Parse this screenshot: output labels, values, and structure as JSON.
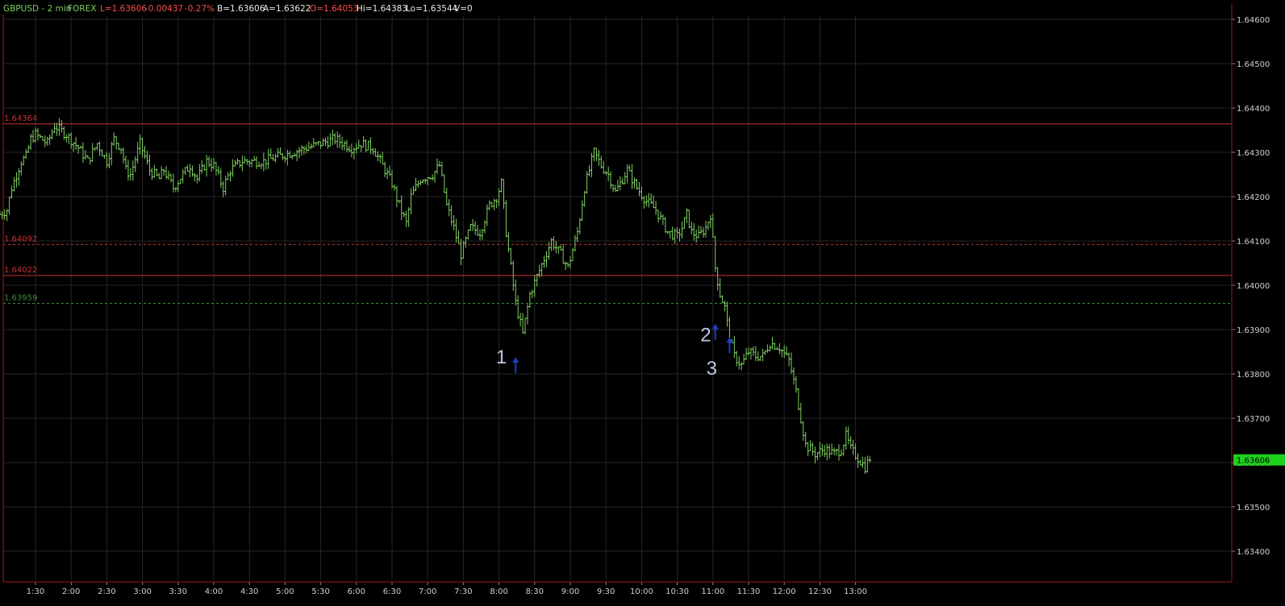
{
  "header": {
    "symbol": "GBPUSD - 2 min",
    "market": "FOREX",
    "last": "L=1.63606",
    "change": "-0.00437",
    "change_pct": "-0.27%",
    "bid": "B=1.63606",
    "ask": "A=1.63622",
    "open": "O=1.64053",
    "high": "Hi=1.64383",
    "low": "Lo=1.63544",
    "volume": "V=0"
  },
  "colors": {
    "background": "#000000",
    "bars": "#7fd061",
    "grid": "#262626",
    "frame": "#a01818",
    "resistance": "#c83232",
    "support_dashed": "#3f8a3f",
    "last_price_badge": "#1ed21e",
    "arrow": "#1e3ccc",
    "annotation": "#b8c6e6"
  },
  "chart_data": {
    "type": "ohlc",
    "title": "GBPUSD - 2 min",
    "ylim": [
      1.6333,
      1.6463
    ],
    "y_ticks": [
      "1.64600",
      "1.64500",
      "1.64400",
      "1.64300",
      "1.64200",
      "1.64100",
      "1.64000",
      "1.63900",
      "1.63800",
      "1.63700",
      "1.63600",
      "1.63500",
      "1.63400"
    ],
    "y_tick_values": [
      1.646,
      1.645,
      1.644,
      1.643,
      1.642,
      1.641,
      1.64,
      1.639,
      1.638,
      1.637,
      1.636,
      1.635,
      1.634
    ],
    "x_ticks": [
      "1:30",
      "2:00",
      "2:30",
      "3:00",
      "3:30",
      "4:00",
      "4:30",
      "5:00",
      "5:30",
      "6:00",
      "6:30",
      "7:00",
      "7:30",
      "8:00",
      "8:30",
      "9:00",
      "9:30",
      "10:00",
      "10:30",
      "11:00",
      "11:30",
      "12:00",
      "12:30",
      "13:00"
    ],
    "x_tick_minutes": [
      90,
      120,
      150,
      180,
      210,
      240,
      270,
      300,
      330,
      360,
      390,
      420,
      450,
      480,
      510,
      540,
      570,
      600,
      630,
      660,
      690,
      720,
      750,
      780
    ],
    "bar_interval_min": 2,
    "last_price": "1.63606",
    "last_price_value": 1.63606,
    "levels": [
      {
        "label": "1.64364",
        "value": 1.64364,
        "style": "solid",
        "color": "#c83232"
      },
      {
        "label": "1.64092",
        "value": 1.64092,
        "style": "dashed",
        "color": "#c83232"
      },
      {
        "label": "1.64022",
        "value": 1.64022,
        "style": "solid",
        "color": "#c83232"
      },
      {
        "label": "1.63959",
        "value": 1.63959,
        "style": "dashed",
        "color": "#3f8a3f"
      }
    ],
    "annotations": [
      {
        "text": "1",
        "minute": 482,
        "price": 1.6384
      },
      {
        "text": "2",
        "minute": 654,
        "price": 1.6389
      },
      {
        "text": "3",
        "minute": 659,
        "price": 1.63815
      }
    ],
    "arrows": [
      {
        "minute": 494,
        "price": 1.6382
      },
      {
        "minute": 662,
        "price": 1.63895
      },
      {
        "minute": 674,
        "price": 1.63865
      }
    ],
    "path_minutes": [
      60,
      66,
      70,
      78,
      82,
      86,
      90,
      100,
      106,
      116,
      126,
      134,
      142,
      150,
      156,
      162,
      166,
      170,
      178,
      186,
      190,
      194,
      198,
      206,
      214,
      220,
      226,
      234,
      240,
      248,
      254,
      264,
      272,
      282,
      294,
      306,
      318,
      330,
      342,
      356,
      364,
      374,
      382,
      390,
      396,
      402,
      406,
      414,
      424,
      430,
      436,
      442,
      448,
      456,
      464,
      472,
      478,
      482,
      486,
      490,
      494,
      500,
      506,
      512,
      518,
      524,
      532,
      538,
      542,
      546,
      552,
      560,
      566,
      572,
      578,
      588,
      596,
      604,
      612,
      622,
      630,
      634,
      638,
      642,
      648,
      654,
      658,
      662,
      666,
      670,
      674,
      678,
      684,
      690,
      696,
      702,
      708,
      716,
      724,
      730,
      738,
      746,
      754,
      762,
      768,
      772,
      776,
      782,
      788,
      792
    ],
    "path_closes": [
      1.6416,
      1.6417,
      1.6422,
      1.6428,
      1.6429,
      1.6433,
      1.6434,
      1.6432,
      1.6436,
      1.6434,
      1.6431,
      1.6428,
      1.6432,
      1.6428,
      1.6433,
      1.6431,
      1.6426,
      1.6425,
      1.6432,
      1.6426,
      1.6425,
      1.6424,
      1.6426,
      1.6422,
      1.6425,
      1.6427,
      1.6424,
      1.6428,
      1.6427,
      1.6422,
      1.6426,
      1.6428,
      1.6428,
      1.6428,
      1.6429,
      1.643,
      1.6431,
      1.6432,
      1.6433,
      1.6431,
      1.6432,
      1.6431,
      1.6427,
      1.6423,
      1.6418,
      1.6414,
      1.642,
      1.6424,
      1.6425,
      1.6427,
      1.6418,
      1.6413,
      1.6407,
      1.6413,
      1.6412,
      1.6418,
      1.642,
      1.6423,
      1.6412,
      1.6404,
      1.6396,
      1.6389,
      1.6398,
      1.6402,
      1.6406,
      1.641,
      1.6407,
      1.6404,
      1.6408,
      1.6412,
      1.6422,
      1.643,
      1.6427,
      1.6425,
      1.6421,
      1.6426,
      1.6422,
      1.6419,
      1.6417,
      1.6412,
      1.6411,
      1.6413,
      1.6416,
      1.6412,
      1.6411,
      1.6413,
      1.6416,
      1.6404,
      1.6398,
      1.6395,
      1.6388,
      1.6384,
      1.6382,
      1.6385,
      1.6384,
      1.6384,
      1.6387,
      1.6386,
      1.6383,
      1.6376,
      1.6364,
      1.6362,
      1.6363,
      1.6362,
      1.6363,
      1.6366,
      1.6363,
      1.6361,
      1.6359,
      1.6361
    ]
  }
}
